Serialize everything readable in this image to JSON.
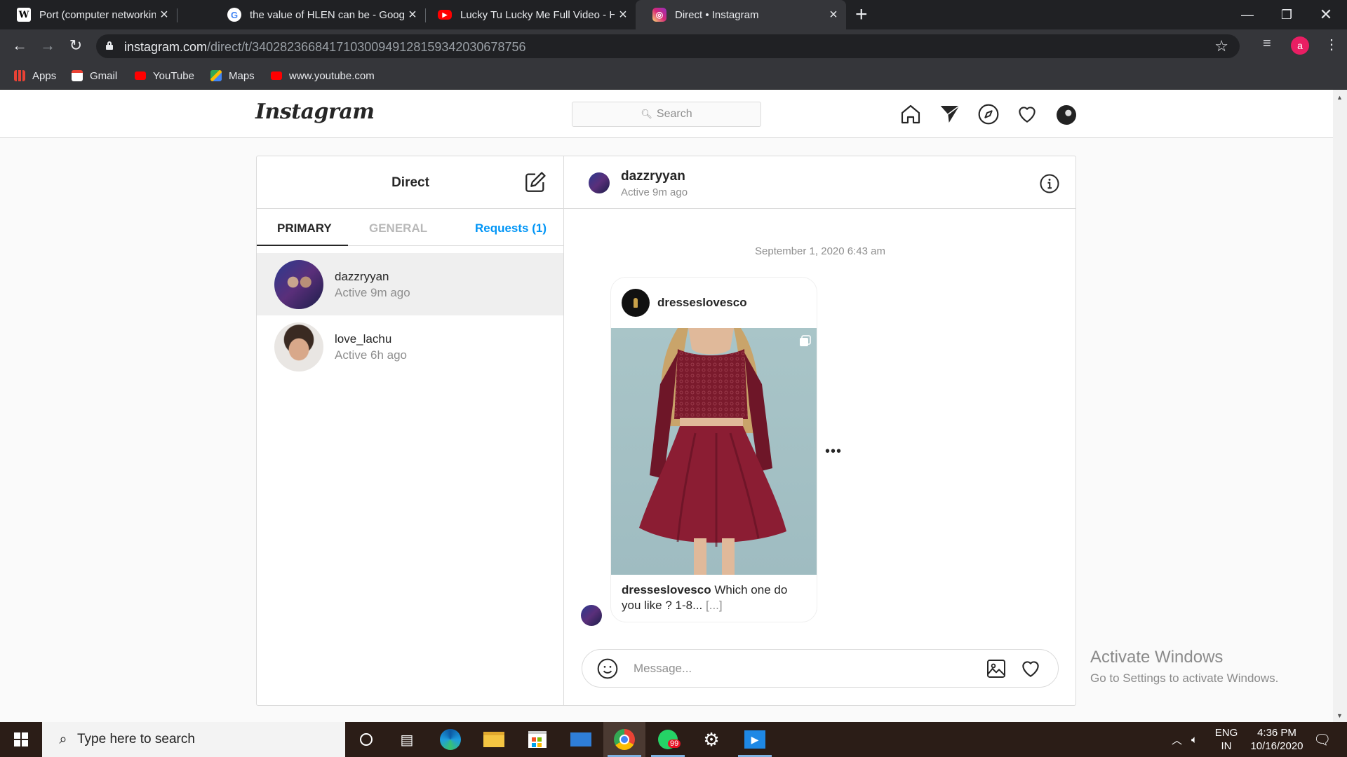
{
  "browser": {
    "tabs": [
      {
        "title": "Port (computer networking) - Wi",
        "icon": "wikipedia-icon"
      },
      {
        "title": "the value of HLEN can be - Goog",
        "icon": "google-icon"
      },
      {
        "title": "Lucky Tu Lucky Me Full Video - H",
        "icon": "youtube-icon"
      },
      {
        "title": "Direct • Instagram",
        "icon": "instagram-icon"
      }
    ],
    "url_domain": "instagram.com",
    "url_path": "/direct/t/340282366841710300949128159342030678756",
    "profile_initial": "a",
    "bookmarks": [
      {
        "label": "Apps",
        "icon": "apps-grid-icon"
      },
      {
        "label": "Gmail",
        "icon": "gmail-icon"
      },
      {
        "label": "YouTube",
        "icon": "youtube-icon"
      },
      {
        "label": "Maps",
        "icon": "maps-icon"
      },
      {
        "label": "www.youtube.com",
        "icon": "youtube-icon"
      }
    ]
  },
  "instagram": {
    "logo": "Instagram",
    "search_placeholder": "Search",
    "direct": {
      "title": "Direct",
      "tabs": {
        "primary": "PRIMARY",
        "general": "GENERAL",
        "requests": "Requests (1)"
      },
      "threads": [
        {
          "name": "dazzryyan",
          "status": "Active 9m ago",
          "selected": true
        },
        {
          "name": "love_lachu",
          "status": "Active 6h ago",
          "selected": false
        }
      ]
    },
    "chat": {
      "name": "dazzryyan",
      "status": "Active 9m ago",
      "timestamp": "September 1, 2020 6:43 am",
      "shared_post": {
        "account": "dresseslovesco",
        "caption_user": "dresseslovesco",
        "caption_text": "Which one do you like ? 1-8...",
        "caption_more": "[...]"
      },
      "message_placeholder": "Message..."
    }
  },
  "watermark": {
    "line1": "Activate Windows",
    "line2": "Go to Settings to activate Windows."
  },
  "taskbar": {
    "search_placeholder": "Type here to search",
    "language": "ENG",
    "region": "IN",
    "time": "4:36 PM",
    "date": "10/16/2020",
    "whatsapp_badge": "99"
  },
  "colors": {
    "instagram_link": "#0095f6",
    "chrome_dark": "#202124",
    "taskbar": "#2b1d17"
  }
}
